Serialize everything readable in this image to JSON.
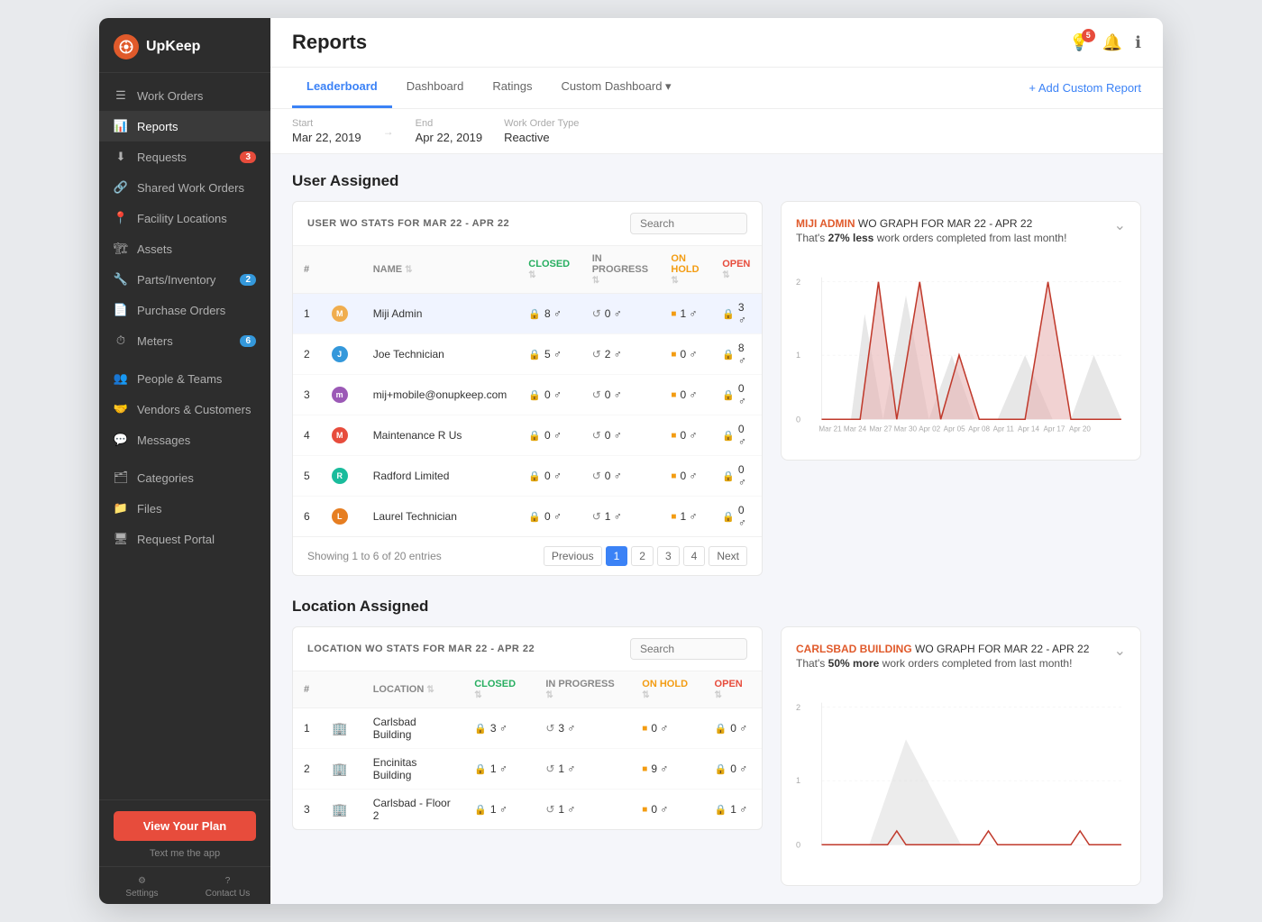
{
  "app": {
    "logo_text": "UpKeep",
    "logo_icon": "U"
  },
  "sidebar": {
    "items": [
      {
        "id": "work-orders",
        "label": "Work Orders",
        "icon": "📋",
        "badge": null
      },
      {
        "id": "reports",
        "label": "Reports",
        "icon": "📊",
        "badge": null,
        "active": true
      },
      {
        "id": "requests",
        "label": "Requests",
        "icon": "📥",
        "badge": "3",
        "badge_color": "red"
      },
      {
        "id": "shared-work-orders",
        "label": "Shared Work Orders",
        "icon": "🔗",
        "badge": null
      },
      {
        "id": "facility-locations",
        "label": "Facility Locations",
        "icon": "📍",
        "badge": null
      },
      {
        "id": "assets",
        "label": "Assets",
        "icon": "🏗️",
        "badge": null
      },
      {
        "id": "parts-inventory",
        "label": "Parts/Inventory",
        "icon": "🔧",
        "badge": "2",
        "badge_color": "blue"
      },
      {
        "id": "purchase-orders",
        "label": "Purchase Orders",
        "icon": "📄",
        "badge": null
      },
      {
        "id": "meters",
        "label": "Meters",
        "icon": "⏱️",
        "badge": "6",
        "badge_color": "blue"
      },
      {
        "id": "people-teams",
        "label": "People & Teams",
        "icon": "👥",
        "badge": null
      },
      {
        "id": "vendors-customers",
        "label": "Vendors & Customers",
        "icon": "🤝",
        "badge": null
      },
      {
        "id": "messages",
        "label": "Messages",
        "icon": "💬",
        "badge": null
      },
      {
        "id": "categories",
        "label": "Categories",
        "icon": "🗂️",
        "badge": null
      },
      {
        "id": "files",
        "label": "Files",
        "icon": "📁",
        "badge": null
      },
      {
        "id": "request-portal",
        "label": "Request Portal",
        "icon": "🖥️",
        "badge": null
      }
    ],
    "view_plan_label": "View Your Plan",
    "text_me_app": "Text me the app",
    "settings_label": "Settings",
    "contact_us_label": "Contact Us"
  },
  "header": {
    "title": "Reports",
    "notification_count": "5"
  },
  "tabs": [
    {
      "id": "leaderboard",
      "label": "Leaderboard",
      "active": true
    },
    {
      "id": "dashboard",
      "label": "Dashboard",
      "active": false
    },
    {
      "id": "ratings",
      "label": "Ratings",
      "active": false
    },
    {
      "id": "custom-dashboard",
      "label": "Custom Dashboard ▾",
      "active": false
    }
  ],
  "add_custom_report_label": "+ Add Custom Report",
  "filters": {
    "start_label": "Start",
    "start_value": "Mar 22, 2019",
    "end_label": "End",
    "end_value": "Apr 22, 2019",
    "work_order_type_label": "Work Order Type",
    "work_order_type_value": "Reactive"
  },
  "user_assigned": {
    "section_title": "User Assigned",
    "table_title": "USER WO STATS FOR MAR 22 - APR 22",
    "search_placeholder": "Search",
    "columns": [
      "#",
      "",
      "NAME",
      "CLOSED",
      "IN PROGRESS",
      "ON HOLD",
      "OPEN"
    ],
    "rows": [
      {
        "rank": 1,
        "name": "Miji Admin",
        "avatar": "M",
        "closed": "8",
        "in_progress": "0",
        "on_hold": "1",
        "open": "3",
        "highlighted": true
      },
      {
        "rank": 2,
        "name": "Joe Technician",
        "avatar": "J",
        "closed": "5",
        "in_progress": "2",
        "on_hold": "0",
        "open": "8",
        "highlighted": false
      },
      {
        "rank": 3,
        "name": "mij+mobile@onupkeep.com",
        "avatar": "m",
        "closed": "0",
        "in_progress": "0",
        "on_hold": "0",
        "open": "0",
        "highlighted": false
      },
      {
        "rank": 4,
        "name": "Maintenance R Us",
        "avatar": "M",
        "closed": "0",
        "in_progress": "0",
        "on_hold": "0",
        "open": "0",
        "highlighted": false
      },
      {
        "rank": 5,
        "name": "Radford Limited",
        "avatar": "R",
        "closed": "0",
        "in_progress": "0",
        "on_hold": "0",
        "open": "0",
        "highlighted": false
      },
      {
        "rank": 6,
        "name": "Laurel Technician",
        "avatar": "L",
        "closed": "0",
        "in_progress": "1",
        "on_hold": "1",
        "open": "0",
        "highlighted": false
      }
    ],
    "pagination": {
      "showing": "Showing 1 to 6 of 20 entries",
      "pages": [
        "Previous",
        "1",
        "2",
        "3",
        "4",
        "Next"
      ]
    }
  },
  "user_chart": {
    "title_strong": "MIJI ADMIN",
    "title_rest": " WO GRAPH FOR MAR 22 - APR 22",
    "subtitle": "That's ",
    "subtitle_strong": "27% less",
    "subtitle_rest": " work orders completed from last month!",
    "y_max": "2",
    "y_mid": "1",
    "y_min": "0",
    "x_labels": [
      "Mar 21",
      "Mar 24",
      "Mar 27",
      "Mar 30",
      "Apr 02",
      "Apr 05",
      "Apr 08",
      "Apr 11",
      "Apr 14",
      "Apr 17",
      "Apr 20"
    ]
  },
  "location_assigned": {
    "section_title": "Location Assigned",
    "table_title": "LOCATION WO STATS FOR MAR 22 - APR 22",
    "search_placeholder": "Search",
    "columns": [
      "#",
      "",
      "LOCATION",
      "CLOSED",
      "IN PROGRESS",
      "ON HOLD",
      "OPEN"
    ],
    "rows": [
      {
        "rank": 1,
        "name": "Carlsbad Building",
        "closed": "3",
        "in_progress": "3",
        "on_hold": "0",
        "open": "0"
      },
      {
        "rank": 2,
        "name": "Encinitas Building",
        "closed": "1",
        "in_progress": "1",
        "on_hold": "9",
        "open": "0"
      },
      {
        "rank": 3,
        "name": "Carlsbad - Floor 2",
        "closed": "1",
        "in_progress": "1",
        "on_hold": "0",
        "open": "1"
      }
    ]
  },
  "location_chart": {
    "title_strong": "CARLSBAD BUILDING",
    "title_rest": " WO GRAPH FOR MAR 22 - APR 22",
    "subtitle": "That's ",
    "subtitle_strong": "50% more",
    "subtitle_rest": " work orders completed from last month!",
    "y_max": "2",
    "y_mid": "1",
    "y_min": "0"
  }
}
